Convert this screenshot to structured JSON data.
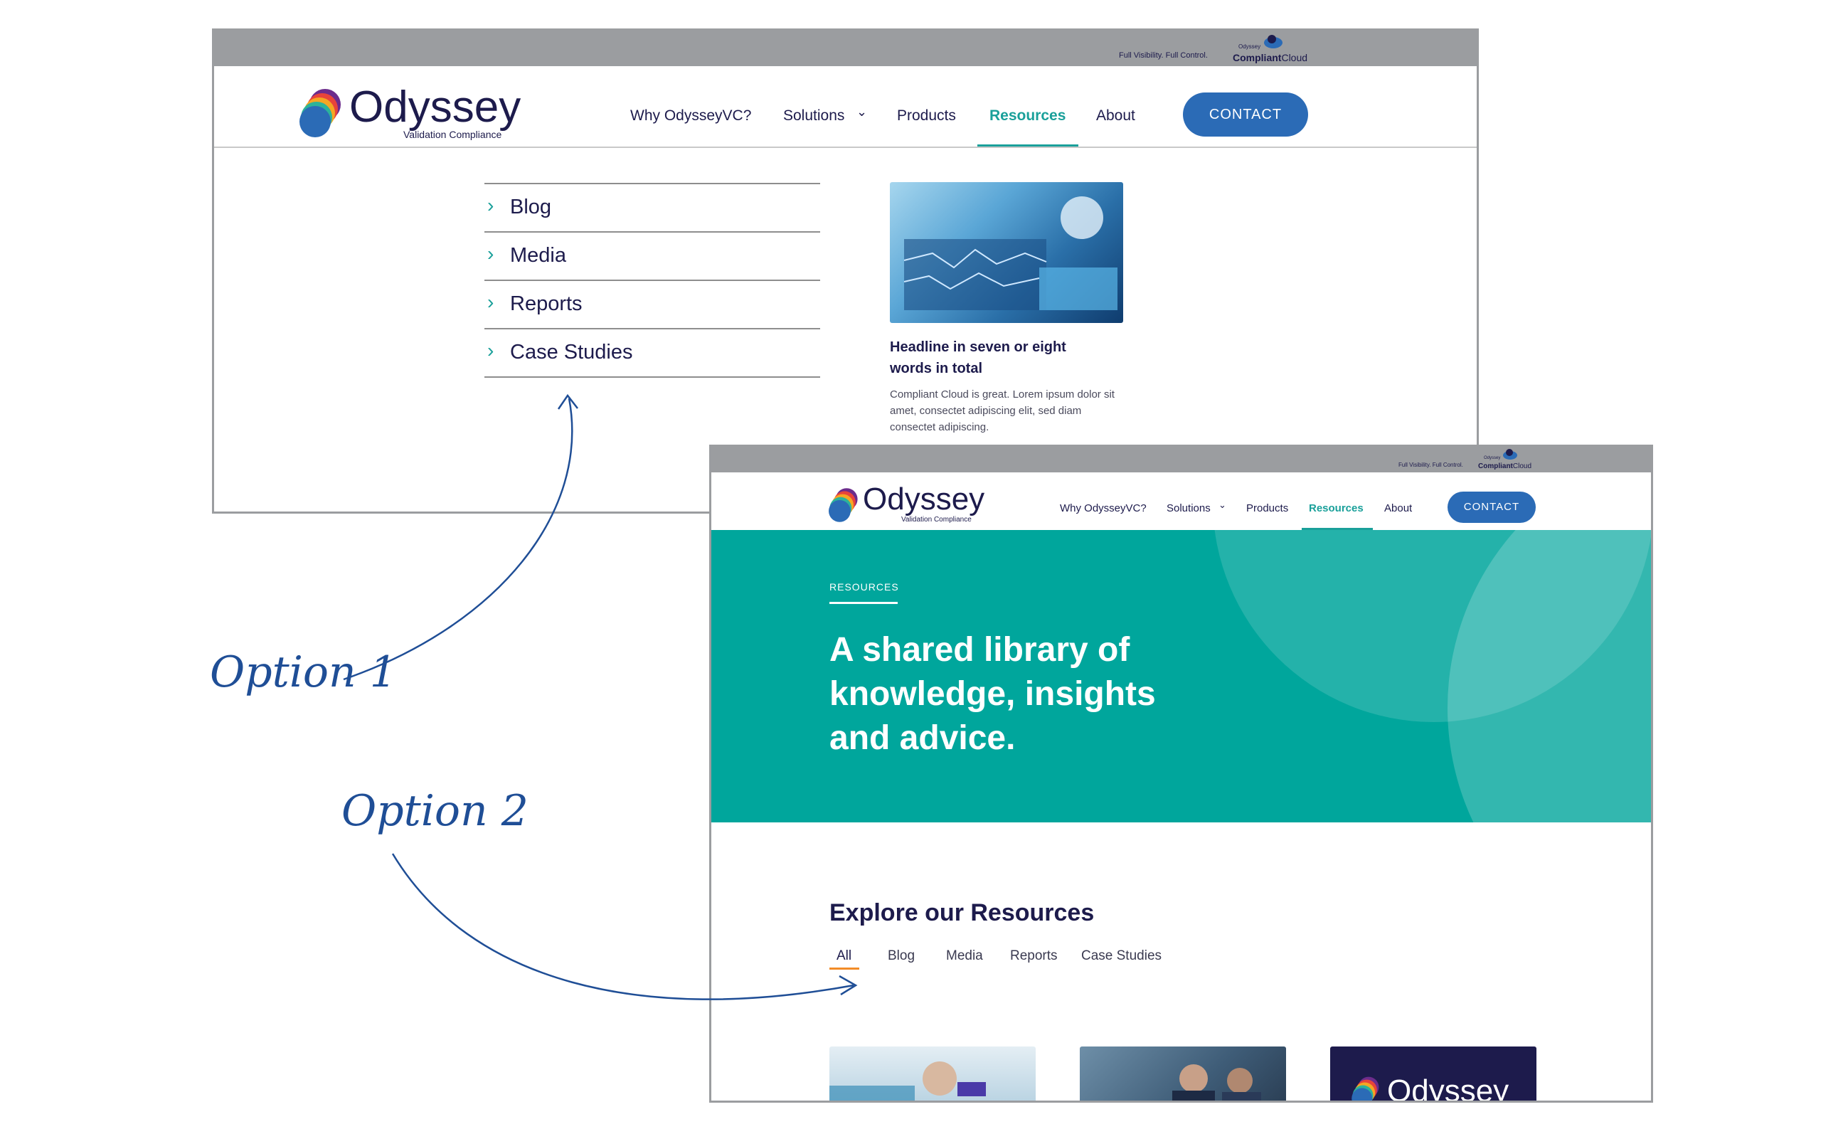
{
  "common": {
    "tagline": "Full Visibility. Full Control.",
    "cc_small": "Odyssey",
    "cc_brand_bold": "Compliant",
    "cc_brand_rest": "Cloud",
    "logo_word": "Odyssey",
    "logo_sub": "Validation Compliance",
    "nav": [
      "Why OdysseyVC?",
      "Solutions",
      "Products",
      "Resources",
      "About"
    ],
    "contact": "CONTACT",
    "colors": {
      "teal": "#00a69c",
      "navy": "#1d1b4c",
      "blue": "#2b6bb6",
      "annotation": "#1f4e96"
    }
  },
  "option1": {
    "menu": [
      "Blog",
      "Media",
      "Reports",
      "Case Studies"
    ],
    "feature": {
      "headline": "Headline in seven or eight words in total",
      "body": "Compliant Cloud is great. Lorem ipsum dolor sit amet, consectet adipiscing elit, sed diam consectet adipiscing."
    }
  },
  "option2": {
    "hero_eyebrow": "RESOURCES",
    "hero_title_lines": [
      "A shared library of",
      "knowledge, insights",
      "and advice."
    ],
    "explore_title": "Explore our Resources",
    "filters": [
      "All",
      "Blog",
      "Media",
      "Reports",
      "Case Studies"
    ],
    "card3_logo": "Odyssey"
  },
  "annotations": {
    "option1": "Option 1",
    "option2": "Option 2"
  }
}
